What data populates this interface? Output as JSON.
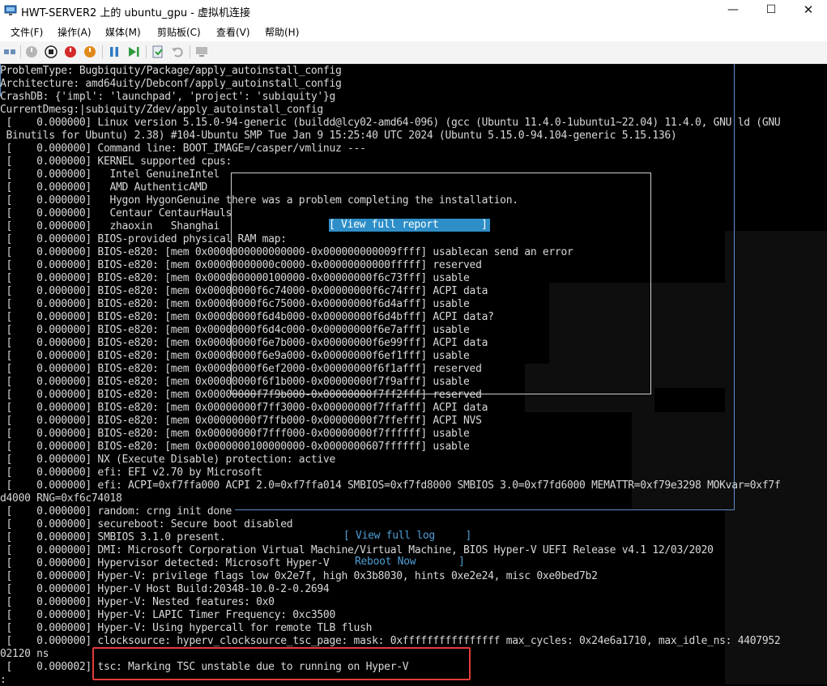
{
  "window": {
    "title": "HWT-SERVER2 上的 ubuntu_gpu - 虚拟机连接",
    "minimize_glyph": "—",
    "maximize_glyph": "☐",
    "close_glyph": "✕"
  },
  "menu": {
    "items": [
      "文件(F)",
      "操作(A)",
      "媒体(M)",
      "剪贴板(C)",
      "查看(V)",
      "帮助(H)"
    ]
  },
  "toolbar": {
    "icons": [
      "ctrl-alt-del-icon",
      "start-icon",
      "turn-off-icon",
      "shutdown-icon",
      "save-state-icon",
      "pause-icon",
      "reset-icon",
      "checkpoint-icon",
      "revert-icon",
      "enhanced-session-icon"
    ]
  },
  "console": {
    "lines": [
      "ProblemType: Bugbiquity/Package/apply_autoinstall_config",
      "Architecture: amd64uity/Debconf/apply_autoinstall_config",
      "CrashDB: {'impl': 'launchpad', 'project': 'subiquity'}g",
      "CurrentDmesg:|subiquity/Zdev/apply_autoinstall_config",
      " [    0.000000] Linux version 5.15.0-94-generic (buildd@lcy02-amd64-096) (gcc (Ubuntu 11.4.0-1ubuntu1~22.04) 11.4.0, GNU ld (GNU",
      " Binutils for Ubuntu) 2.38) #104-Ubuntu SMP Tue Jan 9 15:25:40 UTC 2024 (Ubuntu 5.15.0-94.104-generic 5.15.136)",
      " [    0.000000] Command line: BOOT_IMAGE=/casper/vmlinuz ---",
      " [    0.000000] KERNEL supported cpus:",
      " [    0.000000]   Intel GenuineIntel",
      " [    0.000000]   AMD AuthenticAMD",
      " [    0.000000]   Hygon HygonGenuine there was a problem completing the installation.",
      " [    0.000000]   Centaur CentaurHauls",
      " [    0.000000]   zhaoxin   Shanghai",
      " [    0.000000] BIOS-provided physical RAM map:",
      " [    0.000000] BIOS-e820: [mem 0x0000000000000000-0x000000000009ffff] usablecan send an error",
      " [    0.000000] BIOS-e820: [mem 0x00000000000c0000-0x00000000000fffff] reserved",
      " [    0.000000] BIOS-e820: [mem 0x0000000000100000-0x00000000f6c73fff] usable",
      " [    0.000000] BIOS-e820: [mem 0x00000000f6c74000-0x00000000f6c74fff] ACPI data",
      " [    0.000000] BIOS-e820: [mem 0x00000000f6c75000-0x00000000f6d4afff] usable",
      " [    0.000000] BIOS-e820: [mem 0x00000000f6d4b000-0x00000000f6d4bfff] ACPI data?",
      " [    0.000000] BIOS-e820: [mem 0x00000000f6d4c000-0x00000000f6e7afff] usable",
      " [    0.000000] BIOS-e820: [mem 0x00000000f6e7b000-0x00000000f6e99fff] ACPI data",
      " [    0.000000] BIOS-e820: [mem 0x00000000f6e9a000-0x00000000f6ef1fff] usable",
      " [    0.000000] BIOS-e820: [mem 0x00000000f6ef2000-0x00000000f6f1afff] reserved",
      " [    0.000000] BIOS-e820: [mem 0x00000000f6f1b000-0x00000000f7f9afff] usable",
      " [    0.000000] BIOS-e820: [mem 0x00000000f7f9b000-0x00000000f7ff2fff] reserved",
      " [    0.000000] BIOS-e820: [mem 0x00000000f7ff3000-0x00000000f7ffafff] ACPI data",
      " [    0.000000] BIOS-e820: [mem 0x00000000f7ffb000-0x00000000f7ffefff] ACPI NVS",
      " [    0.000000] BIOS-e820: [mem 0x00000000f7fff000-0x00000000f7ffffff] usable",
      " [    0.000000] BIOS-e820: [mem 0x0000000100000000-0x0000000607ffffff] usable",
      " [    0.000000] NX (Execute Disable) protection: active",
      " [    0.000000] efi: EFI v2.70 by Microsoft",
      " [    0.000000] efi: ACPI=0xf7ffa000 ACPI 2.0=0xf7ffa014 SMBIOS=0xf7fd8000 SMBIOS 3.0=0xf7fd6000 MEMATTR=0xf79e3298 MOKvar=0xf7f",
      "d4000 RNG=0xf6c74018",
      " [    0.000000] random: crng init done",
      " [    0.000000] secureboot: Secure boot disabled",
      " [    0.000000] SMBIOS 3.1.0 present.",
      " [    0.000000] DMI: Microsoft Corporation Virtual Machine/Virtual Machine, BIOS Hyper-V UEFI Release v4.1 12/03/2020",
      " [    0.000000] Hypervisor detected: Microsoft Hyper-V",
      " [    0.000000] Hyper-V: privilege flags low 0x2e7f, high 0x3b8030, hints 0xe2e24, misc 0xe0bed7b2",
      " [    0.000000] Hyper-V Host Build:20348-10.0-2-0.2694",
      " [    0.000000] Hyper-V: Nested features: 0x0",
      " [    0.000000] Hyper-V: LAPIC Timer Frequency: 0xc3500",
      " [    0.000000] Hyper-V: Using hypercall for remote TLB flush",
      " [    0.000000] clocksource: hyperv_clocksource_tsc_page: mask: 0xffffffffffffffff max_cycles: 0x24e6a1710, max_idle_ns: 4407952",
      "02120 ns",
      " [    0.000002] tsc: Marking TSC unstable due to running on Hyper-V",
      ":"
    ],
    "view_report_label": "[ View full report       ]",
    "view_log_label": "[ View full log     ]",
    "reboot_label": "Reboot Now       ]"
  }
}
